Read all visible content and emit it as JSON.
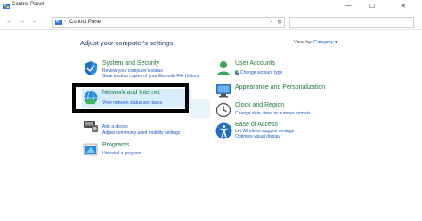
{
  "window": {
    "title": "Control Panel",
    "min_glyph": "—",
    "max_glyph": "☐",
    "close_glyph": "✕"
  },
  "nav": {
    "back_glyph": "←",
    "forward_glyph": "→",
    "recent_glyph": "⌄",
    "up_glyph": "↑",
    "breadcrumb_sep": "›",
    "breadcrumb": "Control Panel",
    "address_dropdown_glyph": "⌄",
    "refresh_glyph": "↻",
    "search_placeholder": ""
  },
  "main": {
    "heading": "Adjust your computer's settings",
    "view_by_label": "View by:",
    "view_by_value": "Category ▾"
  },
  "categories_left": [
    {
      "title": "System and Security",
      "icon": "shield-icon",
      "links": [
        "Review your computer's status",
        "Save backup copies of your files with File History"
      ]
    },
    {
      "title": "Network and Internet",
      "icon": "network-icon",
      "links": [
        "View network status and tasks"
      ]
    },
    {
      "title": "",
      "icon": "hardware-icon",
      "links": [
        "Add a device",
        "Adjust commonly used mobility settings"
      ]
    },
    {
      "title": "Programs",
      "icon": "programs-icon",
      "links": [
        "Uninstall a program"
      ]
    }
  ],
  "categories_right": [
    {
      "title": "User Accounts",
      "icon": "user-icon",
      "links": [
        "Change account type"
      ]
    },
    {
      "title": "Appearance and Personalization",
      "icon": "appearance-icon",
      "links": []
    },
    {
      "title": "Clock and Region",
      "icon": "clock-icon",
      "links": [
        "Change date, time, or number formats"
      ]
    },
    {
      "title": "Ease of Access",
      "icon": "accessibility-icon",
      "links": [
        "Let Windows suggest settings",
        "Optimize visual display"
      ]
    }
  ]
}
